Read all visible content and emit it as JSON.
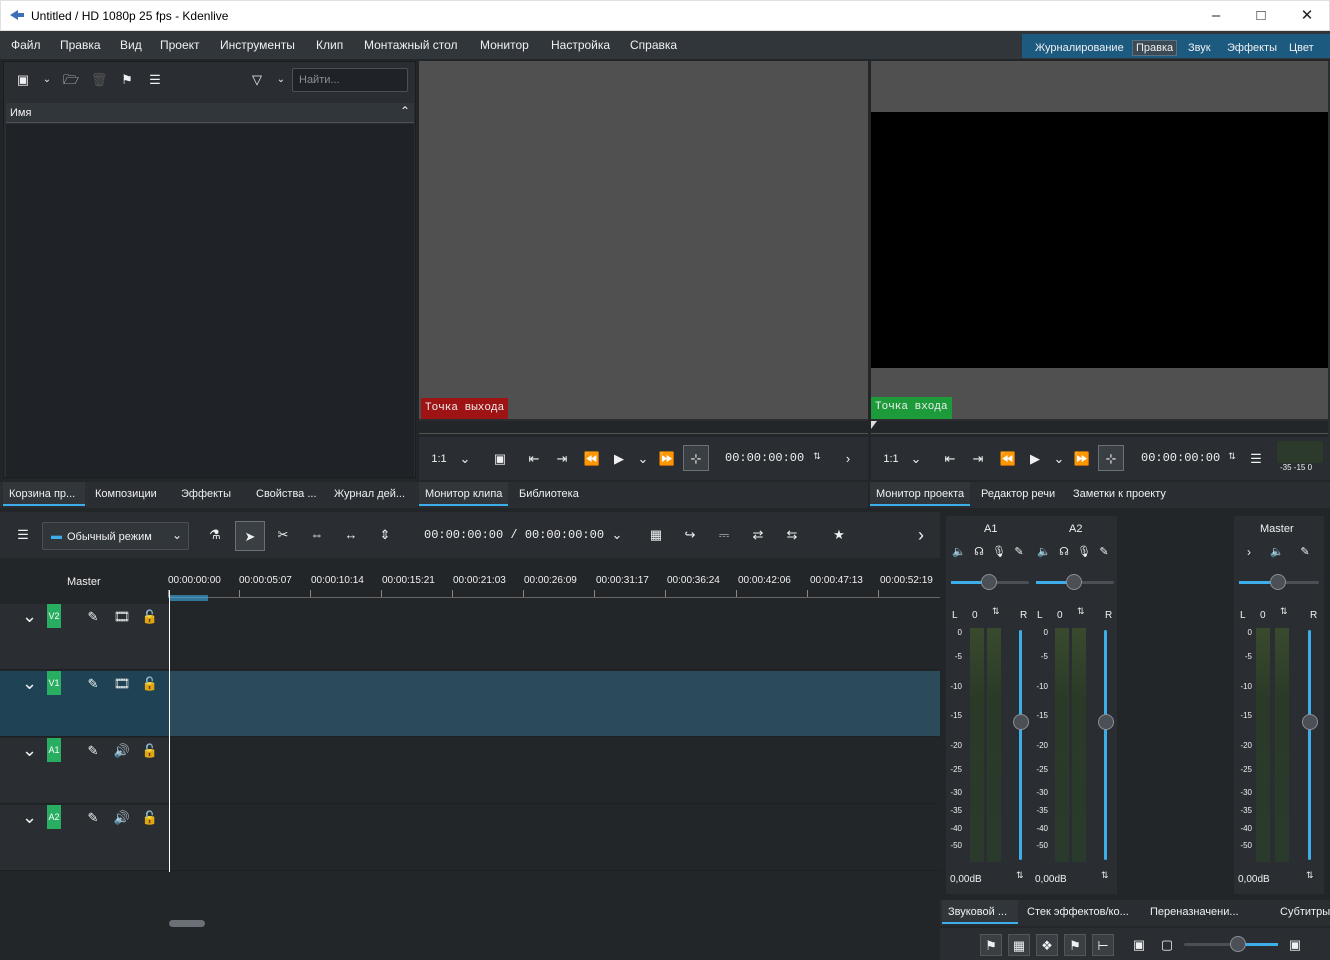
{
  "window": {
    "title": "Untitled / HD 1080p 25 fps - Kdenlive"
  },
  "menu": [
    "Файл",
    "Правка",
    "Вид",
    "Проект",
    "Инструменты",
    "Клип",
    "Монтажный стол",
    "Монитор",
    "Настройка",
    "Справка"
  ],
  "workspaces": [
    "Журналирование",
    "Правка",
    "Звук",
    "Эффекты",
    "Цвет"
  ],
  "bin": {
    "search_placeholder": "Найти...",
    "column_name": "Имя"
  },
  "clip_monitor": {
    "marker": "Точка выхода",
    "zoom": "1:1",
    "timecode": "00:00:00:00"
  },
  "project_monitor": {
    "marker": "Точка входа",
    "zoom": "1:1",
    "timecode": "00:00:00:00",
    "meter_scale": "-35 -15 0"
  },
  "left_tabs": [
    "Корзина пр...",
    "Композиции",
    "Эффекты",
    "Свойства ...",
    "Журнал дей...",
    "Монитор клипа",
    "Библиотека"
  ],
  "right_tabs": [
    "Монитор проекта",
    "Редактор речи",
    "Заметки к проекту"
  ],
  "timeline": {
    "mode": "Обычный режим",
    "position": "00:00:00:00 / 00:00:00:00",
    "master_label": "Master",
    "ruler": [
      "00:00:00:00",
      "00:00:05:07",
      "00:00:10:14",
      "00:00:15:21",
      "00:00:21:03",
      "00:00:26:09",
      "00:00:31:17",
      "00:00:36:24",
      "00:00:42:06",
      "00:00:47:13",
      "00:00:52:19"
    ],
    "tracks": [
      {
        "label": "V2",
        "kind": "video"
      },
      {
        "label": "V1",
        "kind": "video"
      },
      {
        "label": "A1",
        "kind": "audio"
      },
      {
        "label": "A2",
        "kind": "audio"
      }
    ]
  },
  "mixer": {
    "channels": [
      {
        "name": "A1",
        "balance": "0",
        "gain": "0,00dB"
      },
      {
        "name": "A2",
        "balance": "0",
        "gain": "0,00dB"
      },
      {
        "name": "Master",
        "balance": "0",
        "gain": "0,00dB"
      }
    ],
    "l": "L",
    "r": "R",
    "scale": [
      "0",
      "-5",
      "-10",
      "-15",
      "-20",
      "-25",
      "-30",
      "-35",
      "-40",
      "-50"
    ]
  },
  "bottom_tabs": [
    "Звуковой ...",
    "Стек эффектов/ко...",
    "Переназначени...",
    "Субтитры"
  ]
}
